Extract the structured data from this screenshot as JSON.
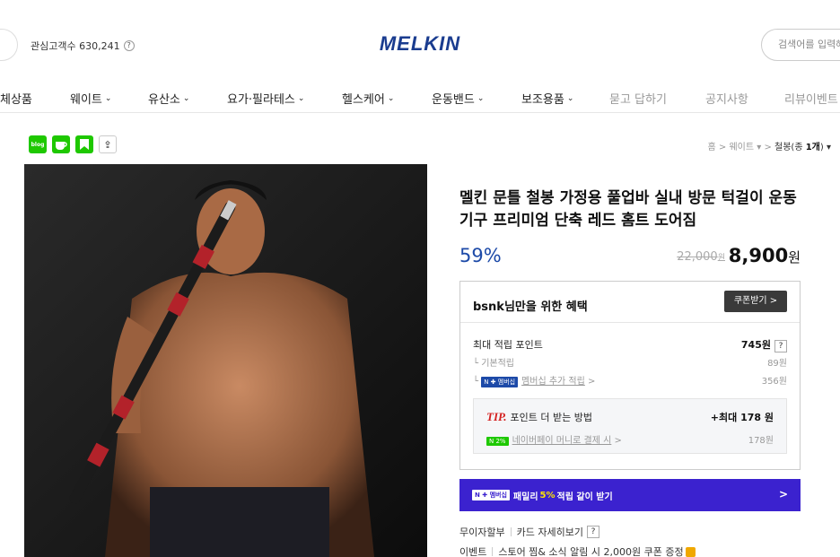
{
  "header": {
    "interest_label": "관심고객수 630,241",
    "help_glyph": "?",
    "logo": "MELKIN",
    "search_placeholder": "검색어를 입력해"
  },
  "nav": {
    "items": [
      {
        "label": "체상품",
        "has_dropdown": false
      },
      {
        "label": "웨이트",
        "has_dropdown": true
      },
      {
        "label": "유산소",
        "has_dropdown": true
      },
      {
        "label": "요가·필라테스",
        "has_dropdown": true
      },
      {
        "label": "헬스케어",
        "has_dropdown": true
      },
      {
        "label": "운동밴드",
        "has_dropdown": true
      },
      {
        "label": "보조용품",
        "has_dropdown": true
      },
      {
        "label": "묻고 답하기",
        "has_dropdown": false
      },
      {
        "label": "공지사항",
        "has_dropdown": false
      },
      {
        "label": "리뷰이벤트",
        "has_dropdown": false
      }
    ]
  },
  "share": {
    "blog_label": "blog",
    "share_glyph": "⇪"
  },
  "breadcrumb": {
    "home": "홈",
    "sep": ">",
    "category": "웨이트 ▾",
    "current_prefix": "철봉(종 ",
    "current_count": "1개",
    "current_suffix": ") ▾"
  },
  "product": {
    "title": "멜킨 문틀 철봉 가정용 풀업바 실내 방문 턱걸이 운동기구 프리미엄 단축 레드 홈트 도어짐",
    "discount": "59%",
    "original_price": "22,000",
    "original_unit": "원",
    "price": "8,900",
    "price_unit": "원"
  },
  "benefit": {
    "header": "bsnk님만을 위한 혜택",
    "coupon_button": "쿠폰받기 >",
    "max_points_label": "최대 적립 포인트",
    "max_points_value": "745원",
    "basic_label": "기본적립",
    "basic_value": "89원",
    "membership_badge": "N ✚ 멤버십",
    "membership_label": "멤버십 추가 적립",
    "membership_value": "356원",
    "tip_prefix": "TIP.",
    "tip_label": "포인트 더 받는 방법",
    "tip_value": "+최대 178 원",
    "pay_badge": "N 2%",
    "pay_label": "네이버페이 머니로 결제 시",
    "pay_value": "178원"
  },
  "family_bar": {
    "badge": "N ✚ 멤버십",
    "text_before": "패밀리",
    "highlight": "5%",
    "text_after": "적립 같이 받기",
    "arrow": ">"
  },
  "info": {
    "installment": "무이자할부",
    "card_detail": "카드 자세히보기",
    "event_label": "이벤트",
    "event_text": "스토어 찜& 소식 알림 시 2,000원 쿠폰 증정"
  },
  "colors": {
    "logo": "#1a3c8f",
    "discount": "#1d4aa8",
    "family_bar": "#3b22cf",
    "naver_green": "#1ec800"
  }
}
